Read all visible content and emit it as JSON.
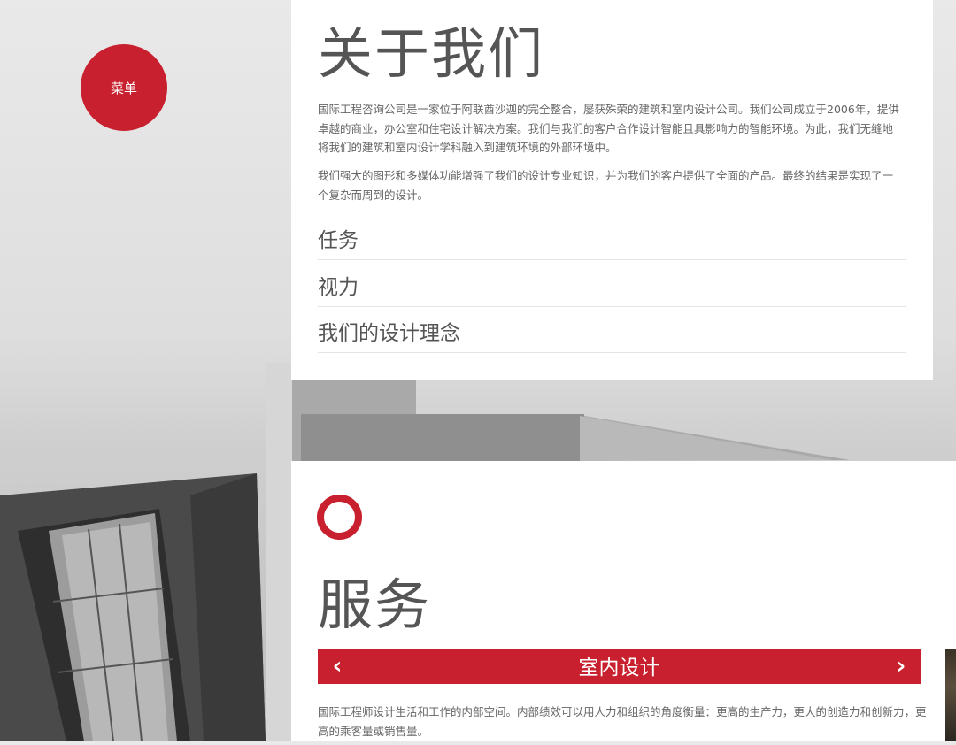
{
  "menu": {
    "label": "菜单"
  },
  "about": {
    "title": "关于我们",
    "paragraph1": "国际工程咨询公司是一家位于阿联酋沙迦的完全整合，屡获殊荣的建筑和室内设计公司。我们公司成立于2006年，提供卓越的商业，办公室和住宅设计解决方案。我们与我们的客户合作设计智能且具影响力的智能环境。为此，我们无缝地将我们的建筑和室内设计学科融入到建筑环境的外部环境中。",
    "paragraph2": "我们强大的图形和多媒体功能增强了我们的设计专业知识，并为我们的客户提供了全面的产品。最终的结果是实现了一个复杂而周到的设计。",
    "accordion": [
      {
        "label": "任务"
      },
      {
        "label": "视力"
      },
      {
        "label": "我们的设计理念"
      }
    ]
  },
  "services": {
    "title": "服务",
    "slider": {
      "current_title": "室内设计",
      "prev_icon": "‹",
      "next_icon": "›"
    },
    "description": "国际工程师设计生活和工作的内部空间。内部绩效可以用人力和组织的角度衡量：更高的生产力，更大的创造力和创新力，更高的乘客量或销售量。"
  },
  "colors": {
    "accent": "#c8202e",
    "heading": "#555555",
    "body_text": "#666666"
  }
}
